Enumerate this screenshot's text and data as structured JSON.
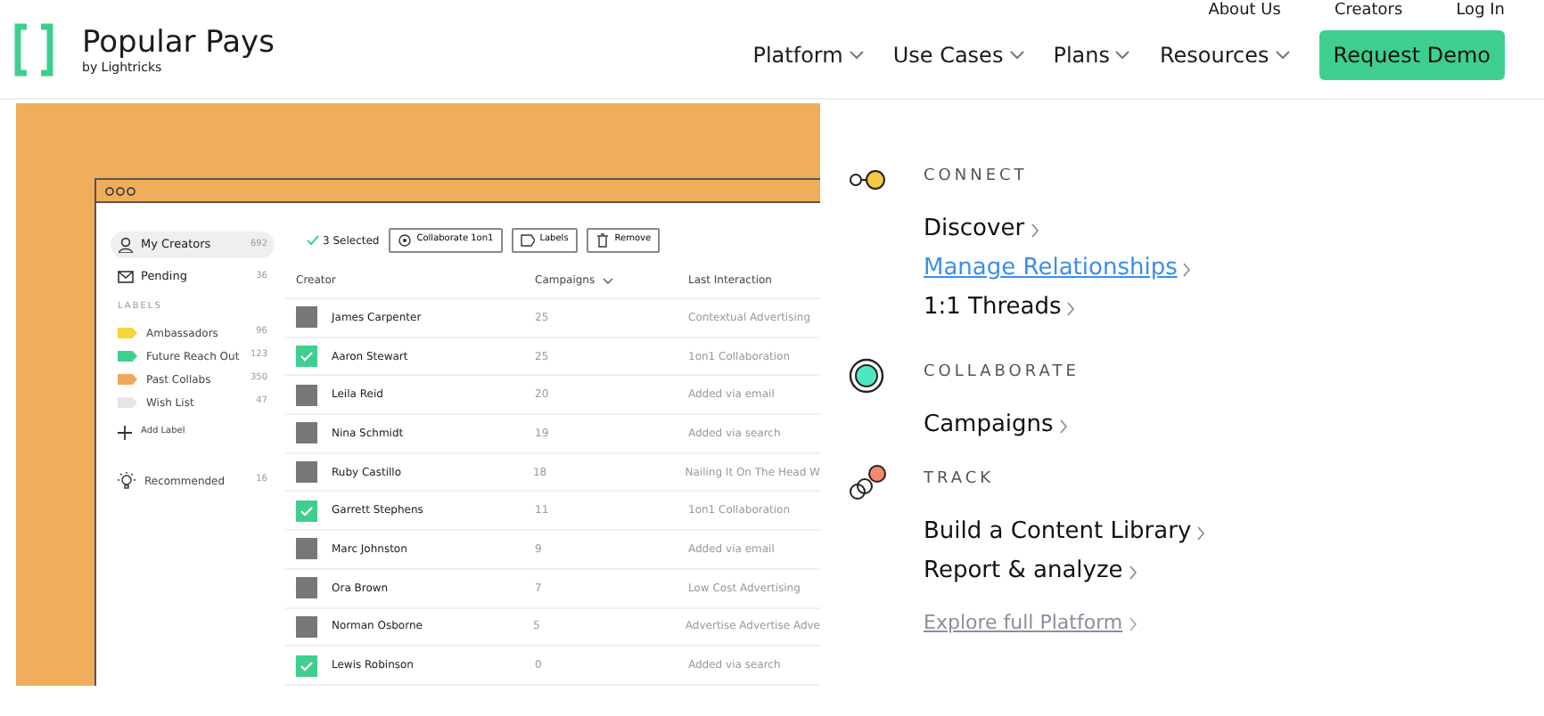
{
  "top_links": [
    "About Us",
    "Creators",
    "Log In"
  ],
  "logo": {
    "name": "Popular Pays",
    "tagline": "by Lightricks"
  },
  "nav": [
    "Platform",
    "Use Cases",
    "Plans",
    "Resources"
  ],
  "cta": "Request Demo",
  "app": {
    "sidebar": [
      {
        "label": "My Creators",
        "count": "692",
        "selected": true,
        "kind": "person"
      },
      {
        "label": "Pending",
        "count": "36",
        "selected": false,
        "kind": "mail"
      }
    ],
    "labels_heading": "LABELS",
    "labels": [
      {
        "label": "Ambassadors",
        "count": "96",
        "color": "#f5d63d"
      },
      {
        "label": "Future Reach Out",
        "count": "123",
        "color": "#3ecf8e"
      },
      {
        "label": "Past Collabs",
        "count": "350",
        "color": "#f0a85a"
      },
      {
        "label": "Wish List",
        "count": "47",
        "color": "#e6e6e6"
      }
    ],
    "add_label": "Add Label",
    "recommended": {
      "label": "Recommended",
      "count": "16"
    },
    "selected_count": "3 Selected",
    "actions": [
      {
        "label": "Collaborate 1on1",
        "kind": "collab"
      },
      {
        "label": "Labels",
        "kind": "label"
      },
      {
        "label": "Remove",
        "kind": "trash"
      }
    ],
    "columns": [
      "Creator",
      "Campaigns",
      "Last Interaction"
    ],
    "rows": [
      {
        "name": "James Carpenter",
        "campaigns": "25",
        "last": "Contextual Advertising",
        "selected": false
      },
      {
        "name": "Aaron Stewart",
        "campaigns": "25",
        "last": "1on1 Collaboration",
        "selected": true
      },
      {
        "name": "Leila Reid",
        "campaigns": "20",
        "last": "Added via email",
        "selected": false
      },
      {
        "name": "Nina Schmidt",
        "campaigns": "19",
        "last": "Added via search",
        "selected": false
      },
      {
        "name": "Ruby Castillo",
        "campaigns": "18",
        "last": "Nailing It On The Head W",
        "selected": false
      },
      {
        "name": "Garrett Stephens",
        "campaigns": "11",
        "last": "1on1 Collaboration",
        "selected": true
      },
      {
        "name": "Marc Johnston",
        "campaigns": "9",
        "last": "Added via email",
        "selected": false
      },
      {
        "name": "Ora Brown",
        "campaigns": "7",
        "last": "Low Cost Advertising",
        "selected": false
      },
      {
        "name": "Norman Osborne",
        "campaigns": "5",
        "last": "Advertise Advertise Adve",
        "selected": false
      },
      {
        "name": "Lewis Robinson",
        "campaigns": "0",
        "last": "Added via search",
        "selected": true
      }
    ]
  },
  "menu": [
    {
      "heading": "CONNECT",
      "kind": "connect",
      "links": [
        {
          "label": "Discover",
          "selected": false
        },
        {
          "label": "Manage Relationships",
          "selected": true
        },
        {
          "label": "1:1 Threads",
          "selected": false
        }
      ]
    },
    {
      "heading": "COLLABORATE",
      "kind": "collaborate",
      "links": [
        {
          "label": "Campaigns",
          "selected": false
        }
      ]
    },
    {
      "heading": "TRACK",
      "kind": "track",
      "links": [
        {
          "label": "Build a Content Library",
          "selected": false
        },
        {
          "label": "Report & analyze",
          "selected": false
        }
      ]
    }
  ],
  "explore": "Explore full Platform"
}
